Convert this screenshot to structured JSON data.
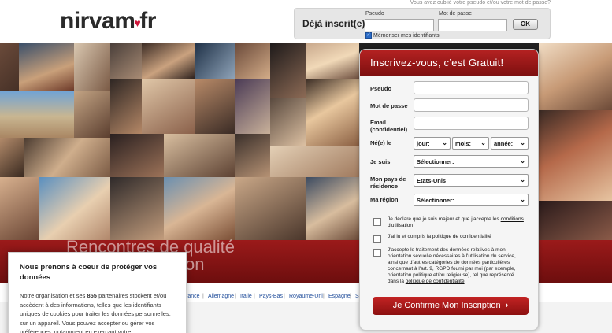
{
  "header": {
    "logo_text": "nirvam",
    "logo_heart": "♥",
    "logo_suffix": "fr",
    "forgot_text": "Vous avez oublié votre pseudo et/ou votre mot de passe?",
    "already_label": "Déjà inscrit(e)",
    "pseudo_label": "Pseudo",
    "password_label": "Mot de passe",
    "ok_label": "OK",
    "remember_label": "Mémoriser mes identifiants",
    "remember_checked": true
  },
  "hero": {
    "tagline_line1": "Rencontres de qualité",
    "tagline_line2": "tion"
  },
  "countries": [
    "rance",
    "Allemagne",
    "Italie",
    "Pays-Bas",
    "Royaume-Uni",
    "Espagne",
    "S"
  ],
  "signup": {
    "title": "Inscrivez-vous, c’est Gratuit!",
    "pseudo_label": "Pseudo",
    "password_label": "Mot de passe",
    "email_label": "Email",
    "email_sub": "(confidentiel)",
    "born_label": "Né(e) le",
    "day_placeholder": "jour:",
    "month_placeholder": "mois:",
    "year_placeholder": "année:",
    "iam_label": "Je suis",
    "iam_value": "Sélectionner:",
    "country_label": "Mon pays de résidence",
    "country_value": "Etats-Unis",
    "region_label": "Ma région",
    "region_value": "Sélectionner:",
    "agree1_text": "Je déclare que je suis majeur et que j'accepte les",
    "agree1_link": "conditions d'utilisation",
    "agree2_text": "J'ai lu et compris la",
    "agree2_link": "politique de confidentialité",
    "agree3_text": "J'accepte le traitement des données relatives à mon orientation sexuelle nécessaires à l'utilisation du service, ainsi que d'autres catégories de données particulières concernant à l'art. 9, RGPD fourni par moi (par exemple, orientation politique et/ou religieuse), tel que représenté dans la",
    "agree3_link": "politique de confidentialité",
    "cta_label": "Je Confirme Mon Inscription",
    "cta_arrow": "›"
  },
  "cookie": {
    "title": "Nous prenons à coeur de protéger vos données",
    "body_pre": "Notre organisation et ses ",
    "body_count": "855",
    "body_post": " partenaires stockent et/ou accèdent à des informations, telles que les identifiants uniques de cookies pour traiter les données personnelles, sur un appareil. Vous pouvez accepter ou gérer vos préférences, notamment en exerçant votre"
  },
  "colors": {
    "brand_red": "#b52222",
    "banner_red": "#8a1414",
    "link_blue": "#1f4c9a"
  }
}
